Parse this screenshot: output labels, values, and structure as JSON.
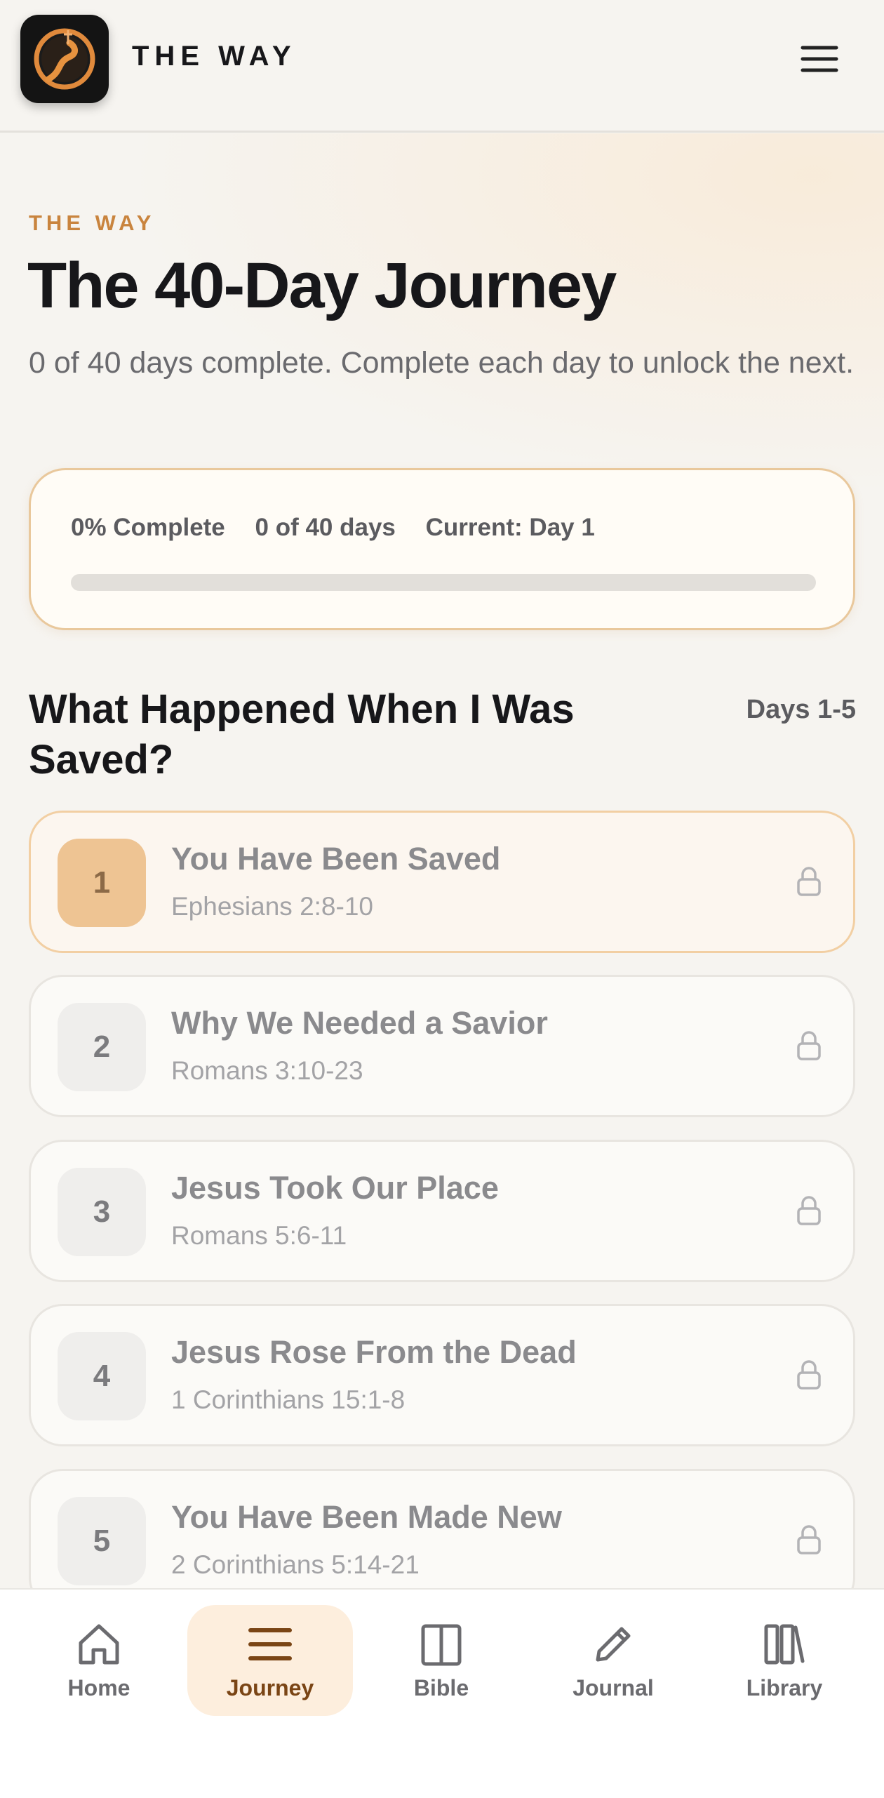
{
  "header": {
    "brand": "THE WAY",
    "logo_icon": "road-cross-logo-icon",
    "menu_icon": "hamburger-menu-icon"
  },
  "hero": {
    "eyebrow": "THE WAY",
    "title": "The 40-Day Journey",
    "subtitle": "0 of 40 days complete. Complete each day to unlock the next."
  },
  "progress": {
    "percent_label": "0% Complete",
    "days_label": "0 of 40 days",
    "current_label": "Current: Day 1",
    "fraction": 0
  },
  "section": {
    "title": "What Happened When I Was Saved?",
    "range": "Days 1-5"
  },
  "days": [
    {
      "number": "1",
      "title": "You Have Been Saved",
      "reference": "Ephesians 2:8-10",
      "state": "current",
      "locked": true
    },
    {
      "number": "2",
      "title": "Why We Needed a Savior",
      "reference": "Romans 3:10-23",
      "state": "locked",
      "locked": true
    },
    {
      "number": "3",
      "title": "Jesus Took Our Place",
      "reference": "Romans 5:6-11",
      "state": "locked",
      "locked": true
    },
    {
      "number": "4",
      "title": "Jesus Rose From the Dead",
      "reference": "1 Corinthians 15:1-8",
      "state": "locked",
      "locked": true
    },
    {
      "number": "5",
      "title": "You Have Been Made New",
      "reference": "2 Corinthians 5:14-21",
      "state": "locked",
      "locked": true
    }
  ],
  "nav": [
    {
      "label": "Home",
      "icon": "home-icon",
      "active": false
    },
    {
      "label": "Journey",
      "icon": "list-icon",
      "active": true
    },
    {
      "label": "Bible",
      "icon": "book-icon",
      "active": false
    },
    {
      "label": "Journal",
      "icon": "pencil-icon",
      "active": false
    },
    {
      "label": "Library",
      "icon": "library-icon",
      "active": false
    }
  ],
  "colors": {
    "accent": "#c9843e",
    "active_nav_bg": "#fdeedd",
    "active_nav_text": "#7a4515",
    "current_day_badge": "#eec493",
    "progress_card_border": "#e9c89c"
  }
}
